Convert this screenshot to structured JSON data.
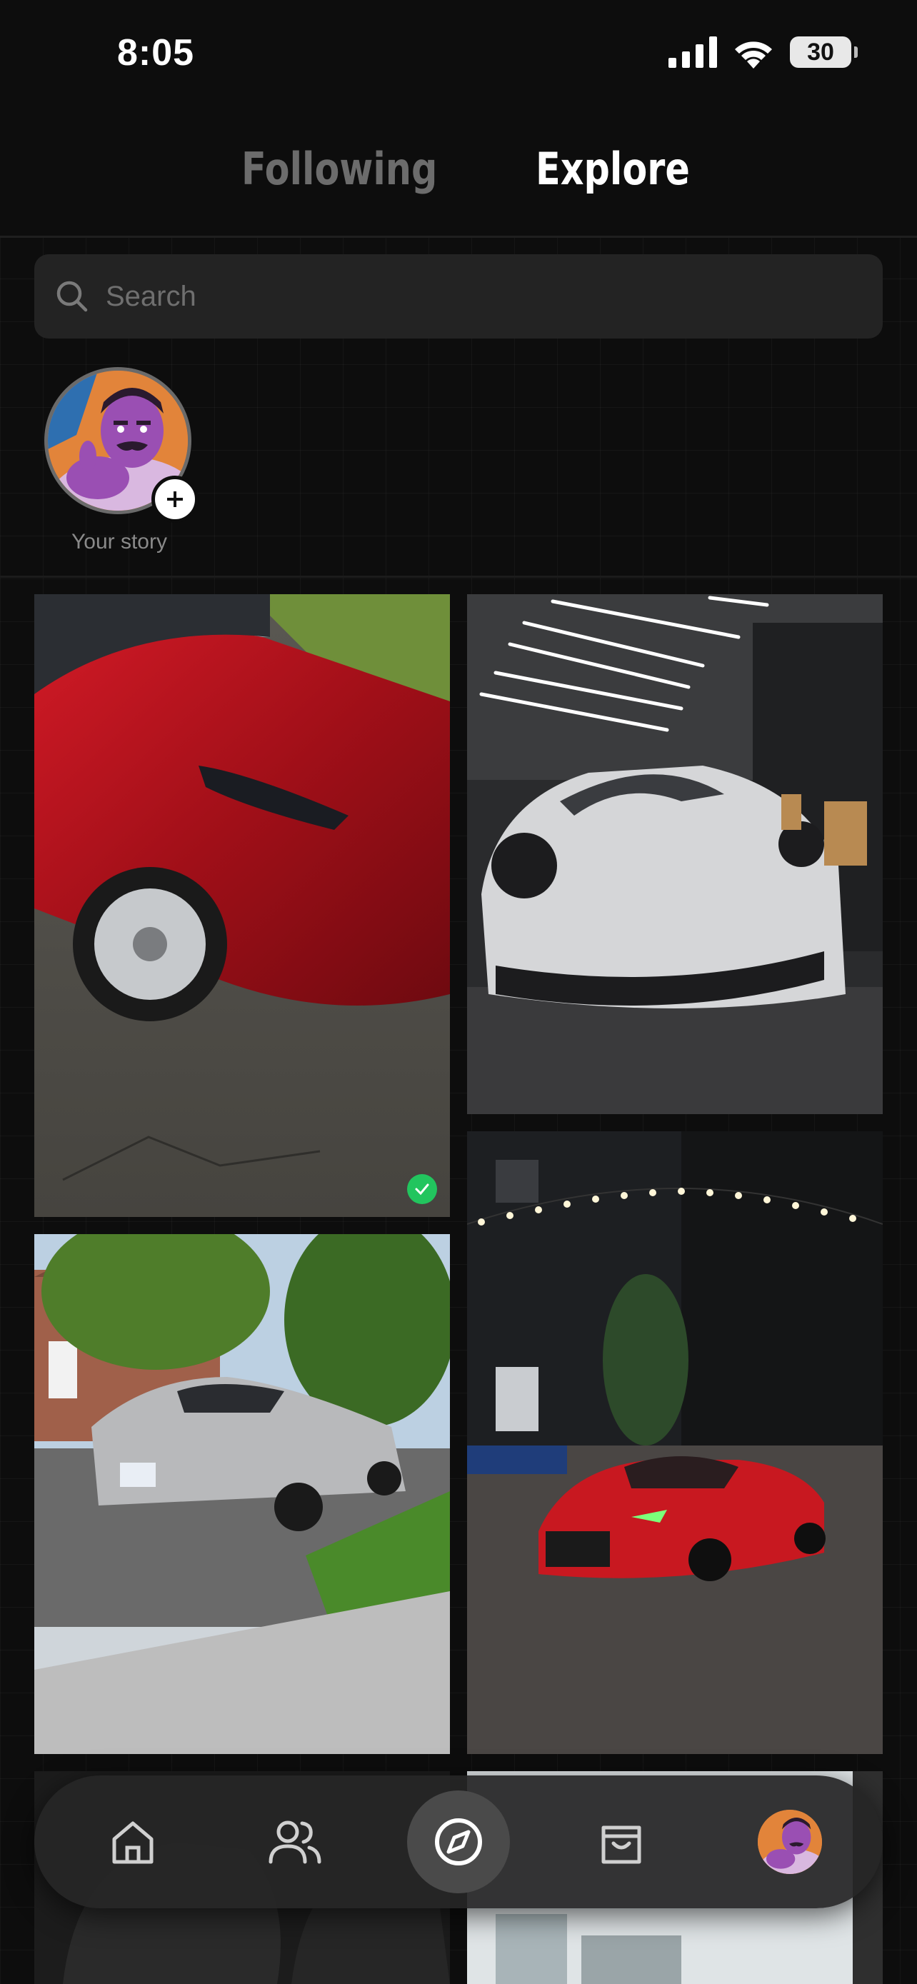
{
  "status_bar": {
    "time": "8:05",
    "battery": "30"
  },
  "tabs": {
    "following": "Following",
    "explore": "Explore",
    "active": "explore"
  },
  "search": {
    "placeholder": "Search",
    "value": ""
  },
  "story": {
    "label": "Your story"
  },
  "nav": {
    "items": [
      "home-icon",
      "friends-icon",
      "compass-icon",
      "bag-icon",
      "profile-avatar"
    ],
    "active": "compass-icon"
  },
  "colors": {
    "background": "#0d0d0d",
    "inactive_tab": "#6c6c6c",
    "verified": "#22c55e"
  }
}
